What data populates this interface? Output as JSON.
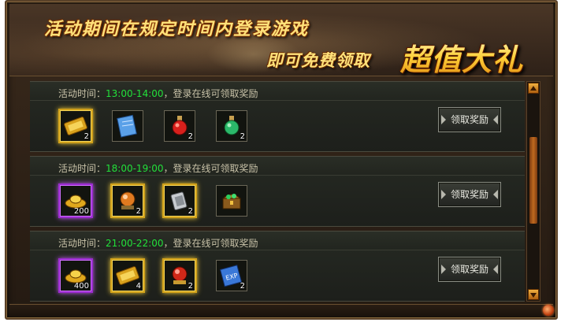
{
  "banner": {
    "line1": "活动期间在规定时间内登录游戏",
    "line2": "即可免费领取",
    "highlight": "超值大礼"
  },
  "rows": [
    {
      "time_label": "活动时间：",
      "time_range": "13:00-14:00",
      "suffix": "，登录在线可领取奖励",
      "button_label": "领取奖励",
      "items": [
        {
          "icon": "gold-ticket-icon",
          "count": "2",
          "frame": "gold"
        },
        {
          "icon": "blue-scroll-icon",
          "count": "",
          "frame": "plain"
        },
        {
          "icon": "red-potion-icon",
          "count": "2",
          "frame": "plain"
        },
        {
          "icon": "green-potion-icon",
          "count": "2",
          "frame": "plain"
        }
      ]
    },
    {
      "time_label": "活动时间：",
      "time_range": "18:00-19:00",
      "suffix": "，登录在线可领取奖励",
      "button_label": "领取奖励",
      "items": [
        {
          "icon": "gold-ingot-icon",
          "count": "200",
          "frame": "purple"
        },
        {
          "icon": "orange-orb-icon",
          "count": "2",
          "frame": "gold"
        },
        {
          "icon": "silver-token-icon",
          "count": "2",
          "frame": "gold"
        },
        {
          "icon": "treasure-chest-icon",
          "count": "",
          "frame": "plain"
        }
      ]
    },
    {
      "time_label": "活动时间：",
      "time_range": "21:00-22:00",
      "suffix": "，登录在线可领取奖励",
      "button_label": "领取奖励",
      "items": [
        {
          "icon": "gold-ingot-icon",
          "count": "400",
          "frame": "purple"
        },
        {
          "icon": "gold-ticket-icon",
          "count": "4",
          "frame": "gold"
        },
        {
          "icon": "red-orb-icon",
          "count": "2",
          "frame": "gold"
        },
        {
          "icon": "exp-scroll-icon",
          "count": "2",
          "frame": "plain"
        }
      ]
    }
  ],
  "exp_scroll_text": "EXP"
}
